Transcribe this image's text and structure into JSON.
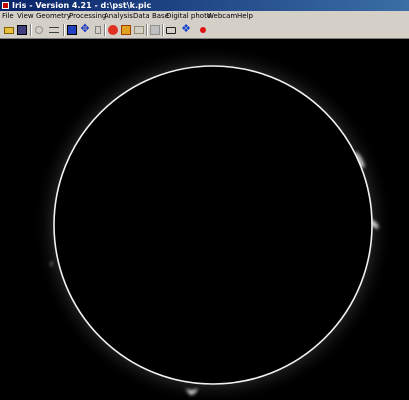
{
  "window": {
    "title": "Iris - Version 4.21 - d:\\pst\\k.pic"
  },
  "menu": {
    "items": [
      "File",
      "View",
      "Geometry",
      "Processing",
      "Analysis",
      "Data Base",
      "Digital photo",
      "Webcam",
      "Help"
    ]
  },
  "toolbar": {
    "buttons": [
      "open-icon",
      "save-icon",
      "undo-icon",
      "settings-icon",
      "select-icon",
      "move-icon",
      "quit-icon",
      "stop-icon",
      "image-icon",
      "gallery-icon",
      "blank-icon",
      "camera-icon",
      "webcam-icon",
      "record-icon"
    ]
  },
  "colors": {
    "titlebar": "#0a246a",
    "chrome": "#d4d0c8",
    "image_background": "#000000",
    "limb": "#f2f2f2"
  }
}
